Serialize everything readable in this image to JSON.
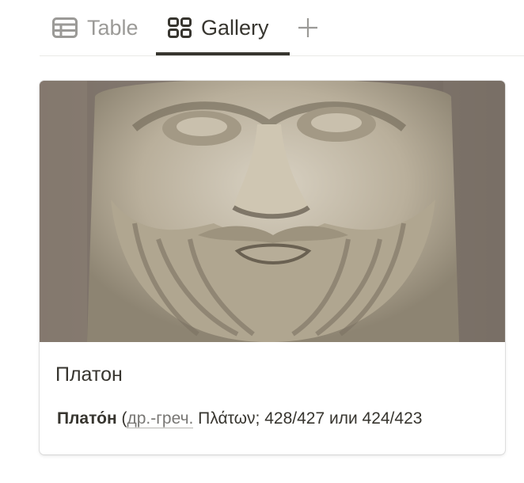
{
  "view_tabs": {
    "table_label": "Table",
    "gallery_label": "Gallery",
    "add_label": "+",
    "active": "Gallery"
  },
  "card": {
    "cover_image": "marble bust of Plato",
    "title": "Платон",
    "excerpt": {
      "bold_name": "Плато́н",
      "paren_open": "(",
      "link_text": "др.-греч.",
      "rest": " Πλάτων; 428/427 или 424/423"
    }
  },
  "colors": {
    "text": "#37352f",
    "muted": "#9b9a97",
    "divider": "#e9e9e7"
  }
}
